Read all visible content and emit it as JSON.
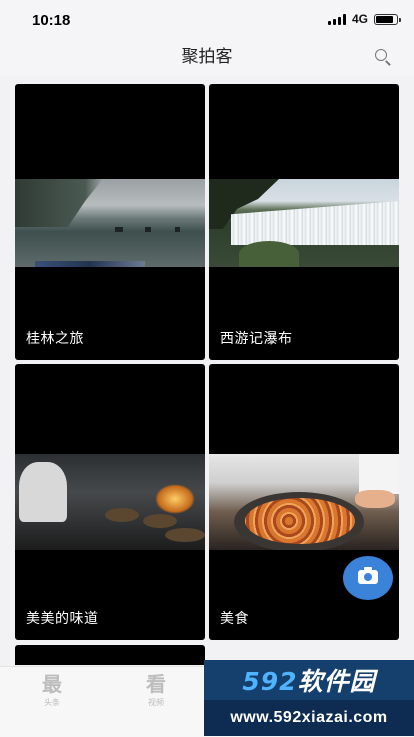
{
  "status_bar": {
    "time": "10:18",
    "network": "4G"
  },
  "nav": {
    "title": "聚拍客",
    "search_icon": "search-icon"
  },
  "cards": [
    {
      "title": "桂林之旅",
      "thumbnail": "river-landscape"
    },
    {
      "title": "西游记瀑布",
      "thumbnail": "waterfall"
    },
    {
      "title": "美美的味道",
      "thumbnail": "kitchen-cooking"
    },
    {
      "title": "美食",
      "thumbnail": "dish-food"
    }
  ],
  "camera_button": {
    "icon": "camera-icon",
    "color": "#3b82d9"
  },
  "tabs": [
    {
      "glyph": "最",
      "label": "头条"
    },
    {
      "glyph": "看",
      "label": "视频"
    }
  ],
  "watermark": {
    "brand_num": "592",
    "brand_text": "软件园",
    "url": "www.592xiazai.com"
  }
}
